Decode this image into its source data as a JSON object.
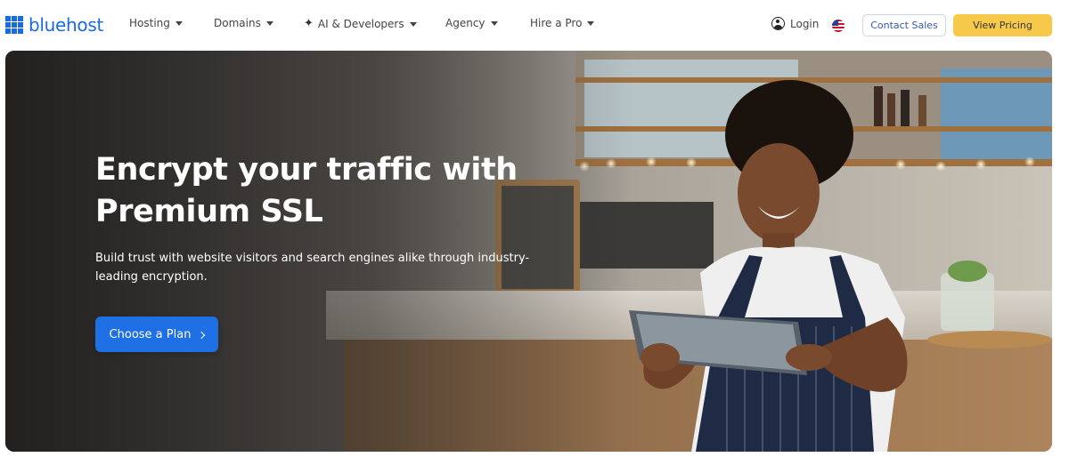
{
  "brand": {
    "name": "bluehost",
    "color": "#196bde"
  },
  "nav": {
    "items": [
      {
        "label": "Hosting",
        "has_dropdown": true
      },
      {
        "label": "Domains",
        "has_dropdown": true
      },
      {
        "label": "AI & Developers",
        "has_dropdown": true,
        "icon": "sparkle-icon"
      },
      {
        "label": "Agency",
        "has_dropdown": true
      },
      {
        "label": "Hire a Pro",
        "has_dropdown": true
      }
    ],
    "login_label": "Login",
    "locale_icon": "us-flag-icon",
    "contact_label": "Contact Sales",
    "pricing_label": "View Pricing"
  },
  "hero": {
    "title_line1": "Encrypt your traffic with",
    "title_line2": "Premium SSL",
    "subtitle_line1": "Build trust with website visitors and search engines alike through industry-",
    "subtitle_line2": "leading encryption.",
    "cta_label": "Choose a Plan",
    "background": "photo of smiling barista in striped apron using a tablet behind a cafe counter"
  },
  "colors": {
    "cta": "#1f6fe5",
    "pricing_button": "#f7c94a"
  }
}
